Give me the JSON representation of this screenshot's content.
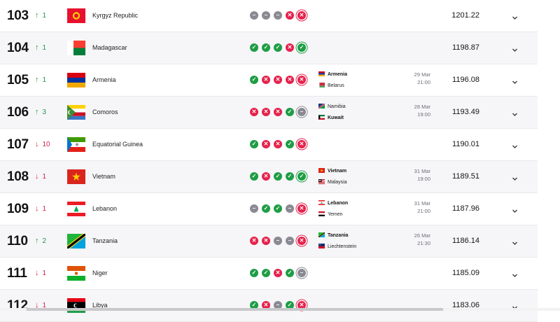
{
  "rows": [
    {
      "rank": "103",
      "dir": "up",
      "change": "1",
      "country": "Kyrgyz Republic",
      "flag": "kgz",
      "form": [
        "d",
        "d",
        "d",
        "l",
        "l"
      ],
      "points": "1201.22",
      "match": null
    },
    {
      "rank": "104",
      "dir": "up",
      "change": "1",
      "country": "Madagascar",
      "flag": "mdg",
      "form": [
        "w",
        "w",
        "w",
        "l",
        "w"
      ],
      "points": "1198.87",
      "match": null
    },
    {
      "rank": "105",
      "dir": "up",
      "change": "1",
      "country": "Armenia",
      "flag": "arm",
      "form": [
        "w",
        "l",
        "l",
        "l",
        "l"
      ],
      "points": "1196.08",
      "match": {
        "team1": "Armenia",
        "flag1": "arm",
        "team2": "Belarus",
        "flag2": "blr",
        "bold": 1,
        "date": "29 Mar",
        "time": "21:00"
      }
    },
    {
      "rank": "106",
      "dir": "up",
      "change": "3",
      "country": "Comoros",
      "flag": "com",
      "form": [
        "l",
        "l",
        "l",
        "w",
        "d"
      ],
      "points": "1193.49",
      "match": {
        "team1": "Namibia",
        "flag1": "nam",
        "team2": "Kuwait",
        "flag2": "kwt",
        "bold": 2,
        "date": "28 Mar",
        "time": "19:00"
      }
    },
    {
      "rank": "107",
      "dir": "down",
      "change": "10",
      "country": "Equatorial Guinea",
      "flag": "gnq",
      "form": [
        "w",
        "l",
        "l",
        "w",
        "l"
      ],
      "points": "1190.01",
      "match": null
    },
    {
      "rank": "108",
      "dir": "down",
      "change": "1",
      "country": "Vietnam",
      "flag": "vnm",
      "form": [
        "w",
        "l",
        "w",
        "w",
        "w"
      ],
      "points": "1189.51",
      "match": {
        "team1": "Vietnam",
        "flag1": "vnm",
        "team2": "Malaysia",
        "flag2": "mys",
        "bold": 1,
        "date": "31 Mar",
        "time": "19:00"
      }
    },
    {
      "rank": "109",
      "dir": "down",
      "change": "1",
      "country": "Lebanon",
      "flag": "lbn",
      "form": [
        "d",
        "w",
        "w",
        "d",
        "l"
      ],
      "points": "1187.96",
      "match": {
        "team1": "Lebanon",
        "flag1": "lbn",
        "team2": "Yemen",
        "flag2": "yem",
        "bold": 1,
        "date": "31 Mar",
        "time": "21:00"
      }
    },
    {
      "rank": "110",
      "dir": "up",
      "change": "2",
      "country": "Tanzania",
      "flag": "tza",
      "form": [
        "l",
        "l",
        "d",
        "d",
        "l"
      ],
      "points": "1186.14",
      "match": {
        "team1": "Tanzania",
        "flag1": "tza",
        "team2": "Liechtenstein",
        "flag2": "lie",
        "bold": 1,
        "date": "26 Mar",
        "time": "21:30"
      }
    },
    {
      "rank": "111",
      "dir": "down",
      "change": "1",
      "country": "Niger",
      "flag": "ner",
      "form": [
        "w",
        "w",
        "l",
        "w",
        "d"
      ],
      "points": "1185.09",
      "match": null
    },
    {
      "rank": "112",
      "dir": "down",
      "change": "1",
      "country": "Libya",
      "flag": "lby",
      "form": [
        "w",
        "l",
        "d",
        "w",
        "l"
      ],
      "points": "1183.06",
      "match": null
    }
  ],
  "icons": {
    "up": "arrow-up-icon",
    "down": "arrow-down-icon",
    "expand": "chevron-down-icon"
  },
  "colors": {
    "win": "#1f9d45",
    "loss": "#e5224d",
    "draw": "#8a8a93",
    "up": "#1c9a4b",
    "down": "#d2244a"
  }
}
